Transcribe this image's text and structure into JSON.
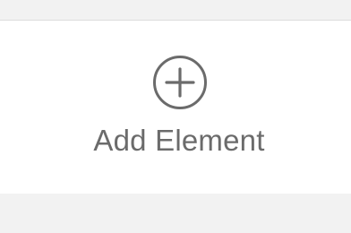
{
  "add_element": {
    "label": "Add Element",
    "icon": "plus-circle-icon",
    "color": "#6b6b6b"
  },
  "colors": {
    "strip_background": "#f2f2f2",
    "panel_background": "#ffffff"
  }
}
